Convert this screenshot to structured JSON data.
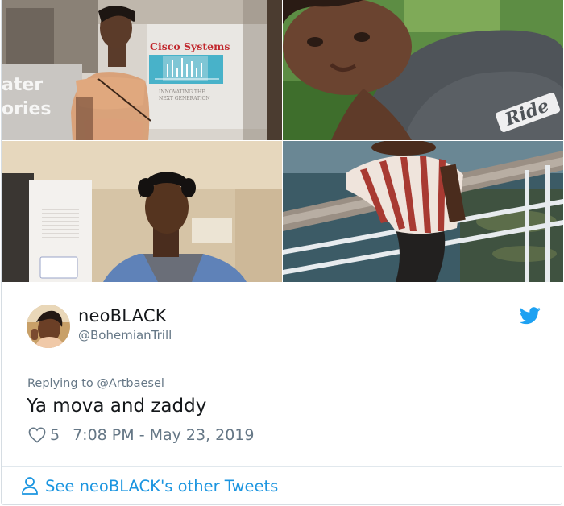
{
  "photos": [
    {
      "name": "photo-storefront",
      "sign_brand": "Cisco Systems",
      "sign_line1": "INNOVATING THE",
      "sign_line2": "NEXT GENERATION",
      "wall_text1": "ater",
      "wall_text2": "ories"
    },
    {
      "name": "photo-selfie",
      "shirt_text": "Ride"
    },
    {
      "name": "photo-indoor"
    },
    {
      "name": "photo-railing"
    }
  ],
  "tweet": {
    "display_name": "neoBLACK",
    "handle": "@BohemianTrill",
    "reply_prefix": "Replying to",
    "reply_to": "@Artbaesel",
    "text": "Ya mova and zaddy",
    "likes": "5",
    "timestamp": "7:08 PM - May 23, 2019",
    "footer_link": "See neoBLACK's other Tweets"
  },
  "colors": {
    "twitter_blue": "#1da1f2",
    "link_blue": "#1b95e0",
    "secondary_text": "#657786",
    "primary_text": "#14171a"
  },
  "icons": {
    "brand": "twitter-bird-icon",
    "like": "heart-icon",
    "profile": "person-icon"
  }
}
